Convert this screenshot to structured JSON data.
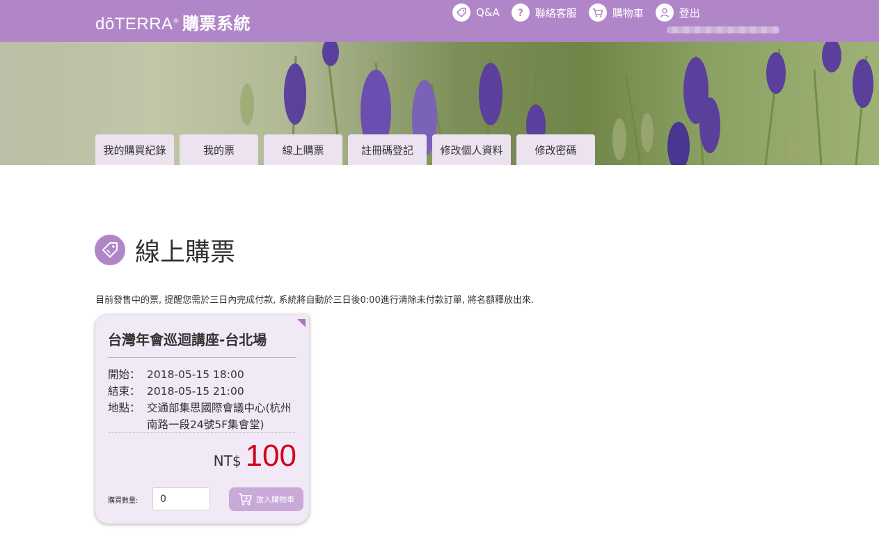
{
  "header": {
    "brand": "dōTERRA",
    "registered": "®",
    "system_name": "購票系統",
    "nav": [
      {
        "label": "Q&A",
        "icon": "tag-icon"
      },
      {
        "label": "聯絡客服",
        "icon": "question-icon"
      },
      {
        "label": "購物車",
        "icon": "cart-icon"
      },
      {
        "label": "登出",
        "icon": "user-icon"
      }
    ]
  },
  "tabs": [
    {
      "label": "我的購買紀錄"
    },
    {
      "label": "我的票"
    },
    {
      "label": "線上購票"
    },
    {
      "label": "註冊碼登記"
    },
    {
      "label": "修改個人資料"
    },
    {
      "label": "修改密碼"
    }
  ],
  "page": {
    "title": "線上購票",
    "notice": "目前發售中的票, 提醒您需於三日內完成付款, 系統將自動於三日後0:00進行清除未付款訂單, 將名額釋放出來."
  },
  "ticket": {
    "title": "台灣年會巡迴講座-台北場",
    "start_label": "開始：",
    "start_value": "2018-05-15 18:00",
    "end_label": "結束：",
    "end_value": "2018-05-15 21:00",
    "location_label": "地點：",
    "location_value": "交通部集思國際會議中心(杭州南路一段24號5F集會堂)",
    "currency": "NT$",
    "price": "100",
    "qty_label": "購買數量:",
    "qty_value": "0",
    "add_to_cart_label": "放入購物車"
  },
  "colors": {
    "brand_purple": "#b186c8",
    "tab_bg": "#ece2f0",
    "card_bg": "#f1e9f5",
    "price_red": "#d0021b",
    "button_bg": "#c8a9d8"
  }
}
